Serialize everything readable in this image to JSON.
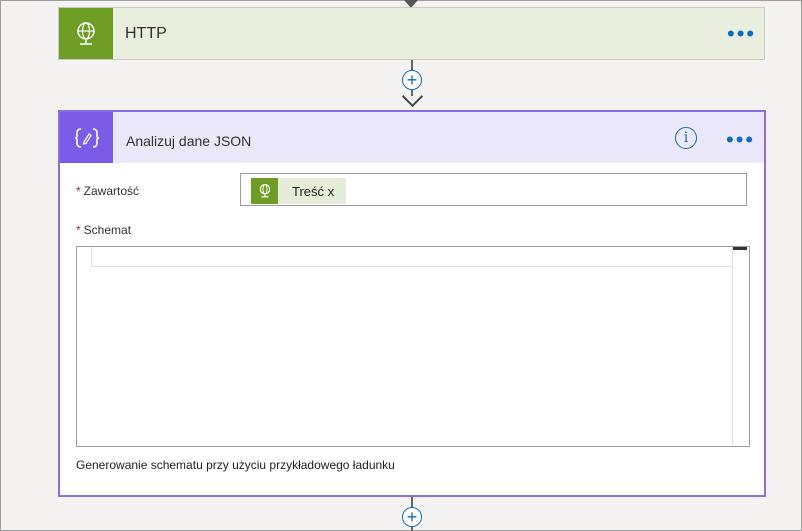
{
  "http_action": {
    "title": "HTTP",
    "icon": "globe-icon",
    "color": "#6e9c25"
  },
  "parse_json_action": {
    "title": "Analizuj dane JSON",
    "icon": "curly-braces-icon",
    "accent": "#7a5ce8",
    "content_label": "Zawartość",
    "content_token": "Treść x",
    "schema_label": "Schemat",
    "schema_value": "",
    "generate_link": "Generowanie schematu przy użyciu przykładowego ładunku"
  },
  "required_marker": "*",
  "connectors": {
    "plus_symbol": "+"
  }
}
